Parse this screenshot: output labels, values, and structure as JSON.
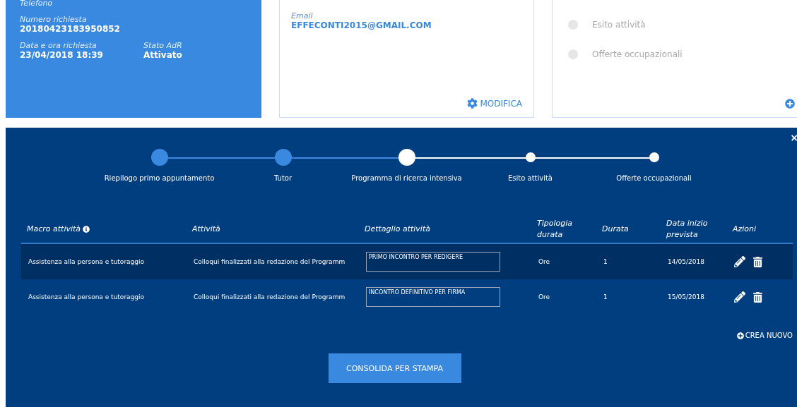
{
  "request_card": {
    "phone_label": "Telefono",
    "fields": [
      {
        "label": "Numero richiesta",
        "value": "20180423183950852"
      }
    ],
    "field_pairs": [
      {
        "label": "Data e ora richiesta",
        "value": "23/04/2018 18:39"
      },
      {
        "label": "Stato AdR",
        "value": "Attivato"
      }
    ]
  },
  "contact_card": {
    "email_label": "Email",
    "email": "EFFECONTI2015@GMAIL.COM",
    "edit_label": "MODIFICA"
  },
  "progress_card": {
    "steps": [
      "Esito attività",
      "Offerte occupazionali"
    ]
  },
  "panel": {
    "close": "×",
    "steps": [
      {
        "label": "Riepilogo primo appuntamento",
        "completed": true,
        "selected": false
      },
      {
        "label": "Tutor",
        "completed": true,
        "selected": false
      },
      {
        "label": "Programma di ricerca intensiva",
        "completed": false,
        "selected": true
      },
      {
        "label": "Esito attività",
        "completed": false,
        "selected": false
      },
      {
        "label": "Offerte occupazionali",
        "completed": false,
        "selected": false
      }
    ],
    "table": {
      "columns": [
        "Macro attività",
        "Attività",
        "Dettaglio attività",
        "Tipologia durata",
        "Durata",
        "Data inizio prevista",
        "Azioni"
      ],
      "rows": [
        {
          "selected": true,
          "macro": "Assistenza alla persona e tutoraggio",
          "activity": "Colloqui finalizzati alla redazione del Programm",
          "detail": "PRIMO INCONTRO PER REDIGERE",
          "type": "Ore",
          "duration": "1",
          "start": "14/05/2018"
        },
        {
          "selected": false,
          "macro": "Assistenza alla persona e tutoraggio",
          "activity": "Colloqui finalizzati alla redazione del Programm",
          "detail": "INCONTRO DEFINITIVO PER FIRMA",
          "type": "Ore",
          "duration": "1",
          "start": "15/05/2018"
        }
      ]
    },
    "create_label": "CREA NUOVO",
    "consolidate_label": "CONSOLIDA PER STAMPA"
  }
}
